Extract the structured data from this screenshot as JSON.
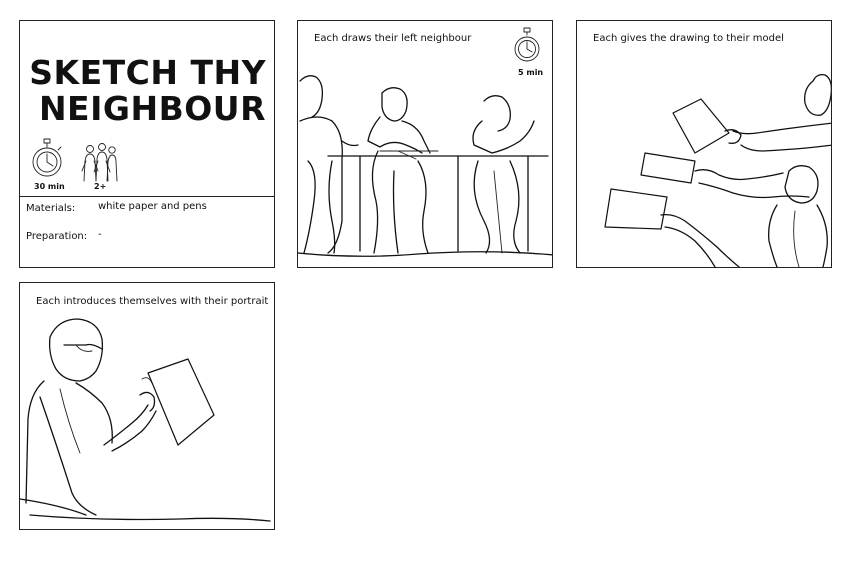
{
  "title": {
    "line1": "SKETCH THY",
    "line2": "NEIGHBOUR"
  },
  "stats": {
    "duration": "30 min",
    "participants": "2+"
  },
  "details": {
    "materials_label": "Materials:",
    "materials_value": "white paper and pens",
    "preparation_label": "Preparation:",
    "preparation_value": "-"
  },
  "steps": [
    {
      "caption": "Each draws their left neighbour",
      "timer": "5 min",
      "icon": "stopwatch-icon"
    },
    {
      "caption": "Each gives the drawing to their model"
    },
    {
      "caption": "Each introduces themselves with their portrait"
    }
  ],
  "icons": {
    "duration": "stopwatch-icon",
    "participants": "people-icon"
  }
}
